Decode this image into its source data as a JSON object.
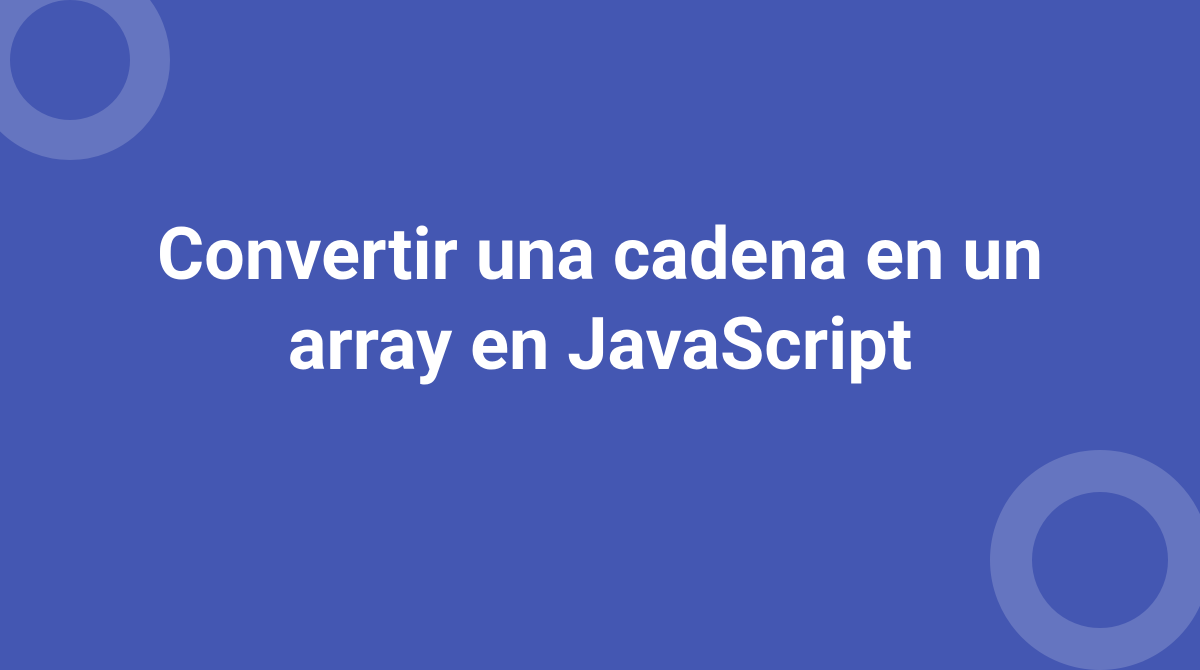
{
  "title": "Convertir una cadena en un array en JavaScript",
  "colors": {
    "background": "#4457b2",
    "text": "#ffffff",
    "ring": "rgba(255, 255, 255, 0.18)"
  }
}
